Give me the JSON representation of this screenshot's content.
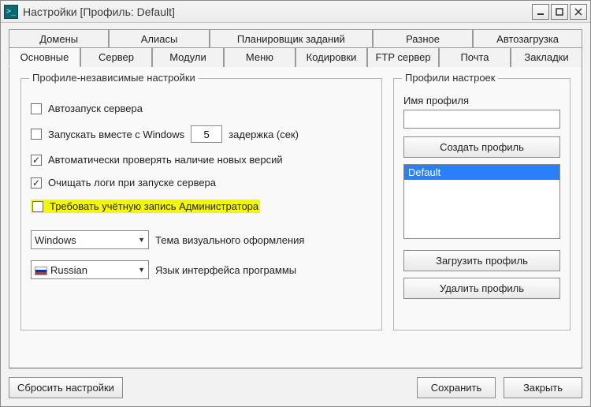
{
  "window": {
    "title": "Настройки [Профиль: Default]"
  },
  "tabs": {
    "row1": [
      "Домены",
      "Алиасы",
      "Планировщик заданий",
      "Разное",
      "Автозагрузка"
    ],
    "row2": [
      "Основные",
      "Сервер",
      "Модули",
      "Меню",
      "Кодировки",
      "FTP сервер",
      "Почта",
      "Закладки"
    ],
    "active": "Основные"
  },
  "group_independent": {
    "legend": "Профиле-независимые настройки",
    "autostart_server": {
      "checked": false,
      "label": "Автозапуск сервера"
    },
    "start_with_windows": {
      "checked": false,
      "label": "Запускать вместе с Windows",
      "delay_value": "5",
      "delay_label": "задержка (сек)"
    },
    "check_updates": {
      "checked": true,
      "label": "Автоматически проверять наличие новых версий"
    },
    "clear_logs": {
      "checked": true,
      "label": "Очищать логи при запуске сервера"
    },
    "require_admin": {
      "checked": false,
      "label": "Требовать учётную запись Администратора"
    },
    "theme": {
      "value": "Windows",
      "label": "Тема визуального оформления"
    },
    "language": {
      "value": "Russian",
      "label": "Язык интерфейса программы"
    }
  },
  "group_profiles": {
    "legend": "Профили настроек",
    "name_label": "Имя профиля",
    "name_value": "",
    "create": "Создать профиль",
    "items": [
      "Default"
    ],
    "load": "Загрузить профиль",
    "delete": "Удалить профиль"
  },
  "footer": {
    "reset": "Сбросить настройки",
    "save": "Сохранить",
    "close": "Закрыть"
  }
}
